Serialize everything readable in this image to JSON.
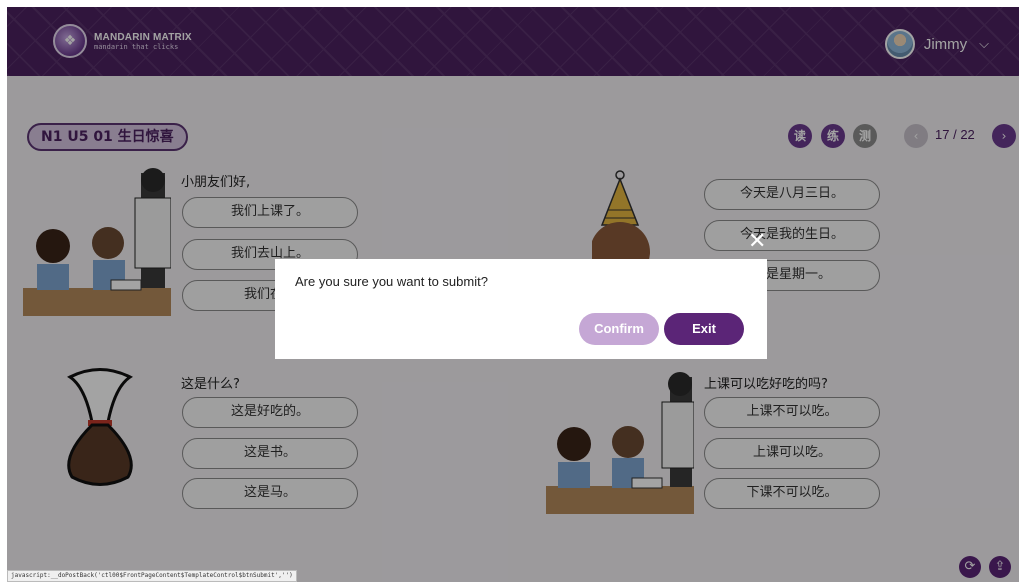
{
  "header": {
    "logo_name": "MANDARIN MATRIX",
    "logo_tagline": "mandarin that clicks",
    "user_name": "Jimmy"
  },
  "lesson": {
    "title": "N1 U5 01 生日惊喜",
    "skills": [
      {
        "label": "读",
        "color": "#6b3a8f"
      },
      {
        "label": "练",
        "color": "#6b3a8f"
      },
      {
        "label": "测",
        "color": "#8e8e8e"
      }
    ],
    "page_current": "17",
    "page_total": "/ 22"
  },
  "questions": [
    {
      "prompt": "小朋友们好,",
      "options": [
        "我们上课了。",
        "我们去山上。",
        "我们在不"
      ]
    },
    {
      "prompt": "",
      "options": [
        "今天是八月三日。",
        "今天是我的生日。",
        "天是星期一。"
      ]
    },
    {
      "prompt": "这是什么?",
      "options": [
        "这是好吃的。",
        "这是书。",
        "这是马。"
      ]
    },
    {
      "prompt": "上课可以吃好吃的吗?",
      "options": [
        "上课不可以吃。",
        "上课可以吃。",
        "下课不可以吃。"
      ]
    }
  ],
  "dialog": {
    "message": "Are you sure you want to submit?",
    "confirm_label": "Confirm",
    "exit_label": "Exit",
    "close_glyph": "✕"
  },
  "status_bar": "javascript:__doPostBack('ctl00$FrontPageContent$TemplateControl$btnSubmit','')",
  "icons": {
    "prev": "‹",
    "next": "›",
    "chevron": "⌵",
    "refresh": "⟳",
    "upload": "⇪"
  }
}
